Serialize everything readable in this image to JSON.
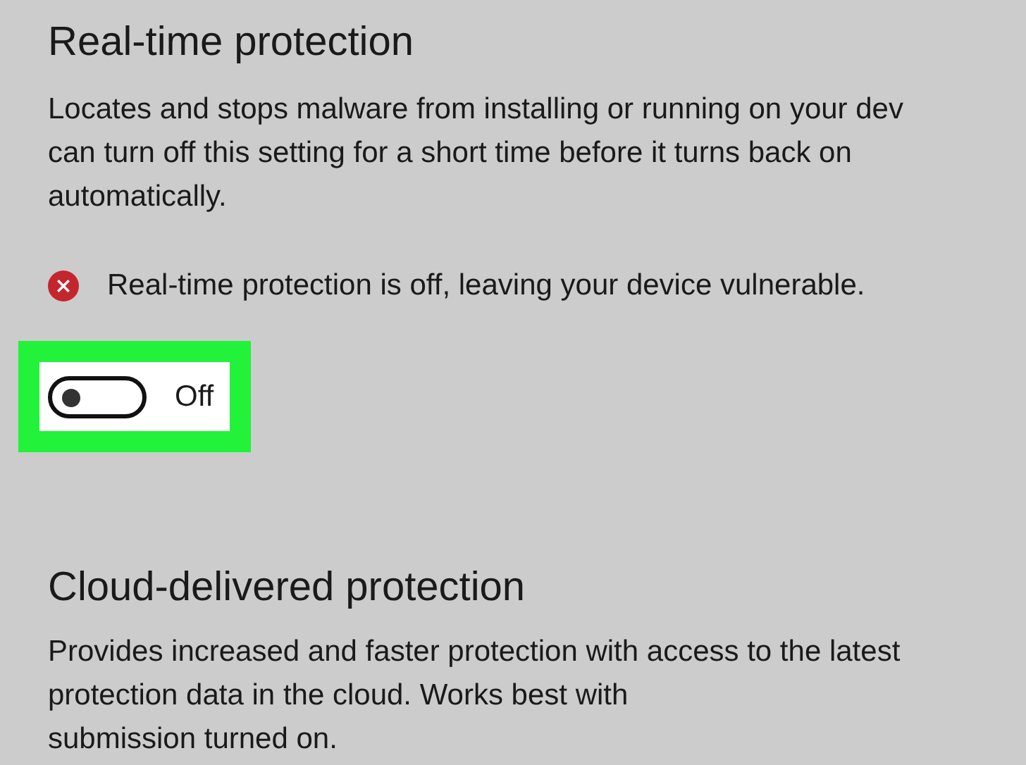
{
  "sections": [
    {
      "title": "Real-time protection",
      "description_lines": [
        "Locates and stops malware from installing or running on your dev",
        "can turn off this setting for a short time before it turns back on",
        "automatically."
      ],
      "alert": {
        "kind": "error",
        "text": "Real-time protection is off, leaving your device vulnerable."
      },
      "toggle": {
        "on": false,
        "label": "Off",
        "highlighted": true
      }
    },
    {
      "title": "Cloud-delivered protection",
      "description_lines": [
        "Provides increased and faster protection with access to the latest",
        "protection data in the cloud.  Works best with",
        "submission turned on."
      ]
    }
  ]
}
